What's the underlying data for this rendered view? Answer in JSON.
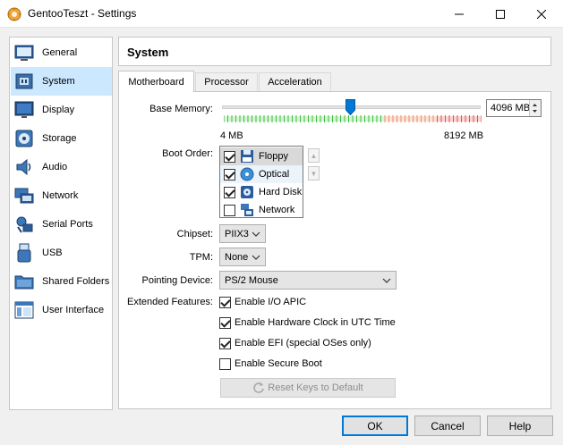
{
  "window": {
    "title": "GentooTeszt - Settings",
    "controls": {
      "minimize": "–",
      "maximize": "□",
      "close": "✕"
    }
  },
  "sidebar": {
    "items": [
      {
        "label": "General",
        "icon": "general-icon",
        "selected": false
      },
      {
        "label": "System",
        "icon": "system-chip-icon",
        "selected": true
      },
      {
        "label": "Display",
        "icon": "display-monitor-icon",
        "selected": false
      },
      {
        "label": "Storage",
        "icon": "storage-disk-icon",
        "selected": false
      },
      {
        "label": "Audio",
        "icon": "audio-speaker-icon",
        "selected": false
      },
      {
        "label": "Network",
        "icon": "network-icon",
        "selected": false
      },
      {
        "label": "Serial Ports",
        "icon": "serial-port-icon",
        "selected": false
      },
      {
        "label": "USB",
        "icon": "usb-icon",
        "selected": false
      },
      {
        "label": "Shared Folders",
        "icon": "shared-folder-icon",
        "selected": false
      },
      {
        "label": "User Interface",
        "icon": "user-interface-icon",
        "selected": false
      }
    ]
  },
  "page": {
    "title": "System",
    "tabs": [
      {
        "label": "Motherboard",
        "active": true
      },
      {
        "label": "Processor",
        "active": false
      },
      {
        "label": "Acceleration",
        "active": false
      }
    ]
  },
  "motherboard": {
    "base_memory": {
      "label": "Base Memory:",
      "value": 4096,
      "value_text": "4096 MB",
      "min_label": "4 MB",
      "max_label": "8192 MB",
      "min": 4,
      "max": 8192
    },
    "boot_order": {
      "label": "Boot Order:",
      "items": [
        {
          "label": "Floppy",
          "checked": true,
          "icon": "floppy-disk-icon",
          "state": "selected"
        },
        {
          "label": "Optical",
          "checked": true,
          "icon": "optical-disc-icon",
          "state": "hover"
        },
        {
          "label": "Hard Disk",
          "checked": true,
          "icon": "hard-disk-icon",
          "state": ""
        },
        {
          "label": "Network",
          "checked": false,
          "icon": "network-boot-icon",
          "state": ""
        }
      ],
      "move_up": "▲",
      "move_down": "▼"
    },
    "chipset": {
      "label": "Chipset:",
      "value": "PIIX3"
    },
    "tpm": {
      "label": "TPM:",
      "value": "None"
    },
    "pointing_device": {
      "label": "Pointing Device:",
      "value": "PS/2 Mouse"
    },
    "extended_features": {
      "label": "Extended Features:",
      "options": [
        {
          "label": "Enable I/O APIC",
          "checked": true
        },
        {
          "label": "Enable Hardware Clock in UTC Time",
          "checked": true
        },
        {
          "label": "Enable EFI (special OSes only)",
          "checked": true
        },
        {
          "label": "Enable Secure Boot",
          "checked": false
        }
      ]
    },
    "reset_keys": {
      "label": "Reset Keys to Default",
      "enabled": false
    }
  },
  "footer": {
    "ok": "OK",
    "cancel": "Cancel",
    "help": "Help"
  },
  "colors": {
    "selection": "#cce8ff",
    "accent": "#0078d7",
    "slider_good": "#6fd16f",
    "slider_warn": "#f3a98a",
    "slider_bad": "#f06868"
  }
}
